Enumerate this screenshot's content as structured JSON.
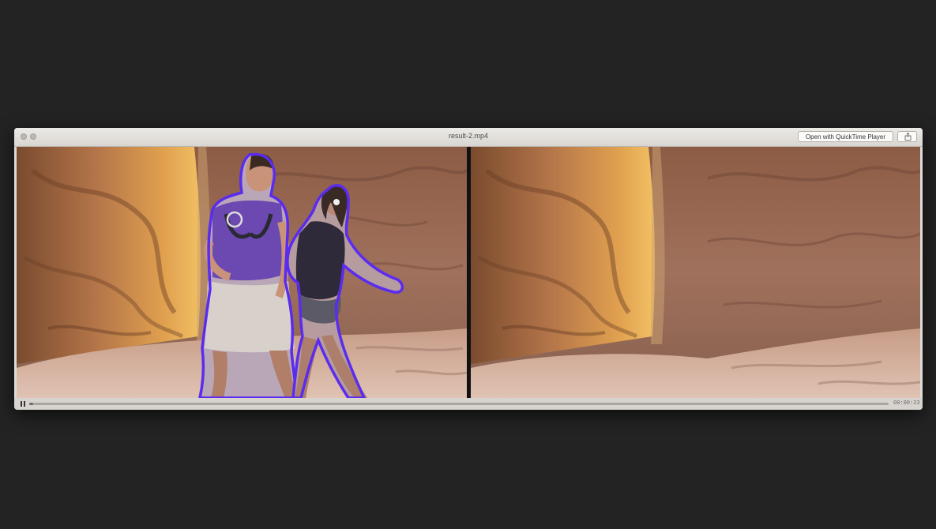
{
  "window": {
    "title": "result-2.mp4"
  },
  "toolbar": {
    "open_with_label": "Open with QuickTime Player",
    "share_icon": "share-icon"
  },
  "player": {
    "state": "playing",
    "control_icon": "pause-icon",
    "progress_fraction": 0.005,
    "timecode": "00:00:23"
  },
  "colors": {
    "outline": "#5a2cf0",
    "desktop_background": "#232323",
    "window_chrome": "#dedbd6"
  }
}
